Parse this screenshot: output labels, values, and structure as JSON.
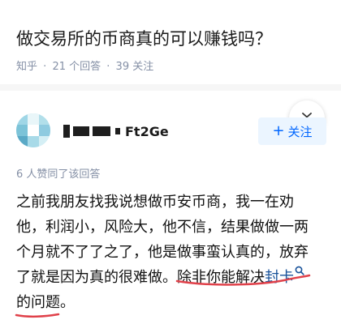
{
  "question": {
    "title": "做交易所的币商真的可以赚钱吗？",
    "source": "知乎",
    "answers_count": "21 个回答",
    "followers_count": "39 关注",
    "separator": "·"
  },
  "author": {
    "name_suffix": "Ft2Ge",
    "follow_label": "关注",
    "follow_plus": "+"
  },
  "answer": {
    "likes_text": "6 人赞同了该回答",
    "line1": "之前我朋友找我说想做币安币商，我一在劝",
    "line2": "他，利润小，风险大，他不信，结果做做一两",
    "line3": "个月就不了了之了，他是做事蛮认真的，放弃",
    "line4_a": "了就是因为真的很难做。除非你能解决",
    "line4_link": "封卡",
    "line5": "的问题。"
  },
  "colors": {
    "accent": "#0066ff",
    "link": "#175199",
    "meta": "#8590a6",
    "annotation": "#e0414a"
  },
  "icons": [
    "collapse-chevron-icon",
    "search-icon"
  ]
}
